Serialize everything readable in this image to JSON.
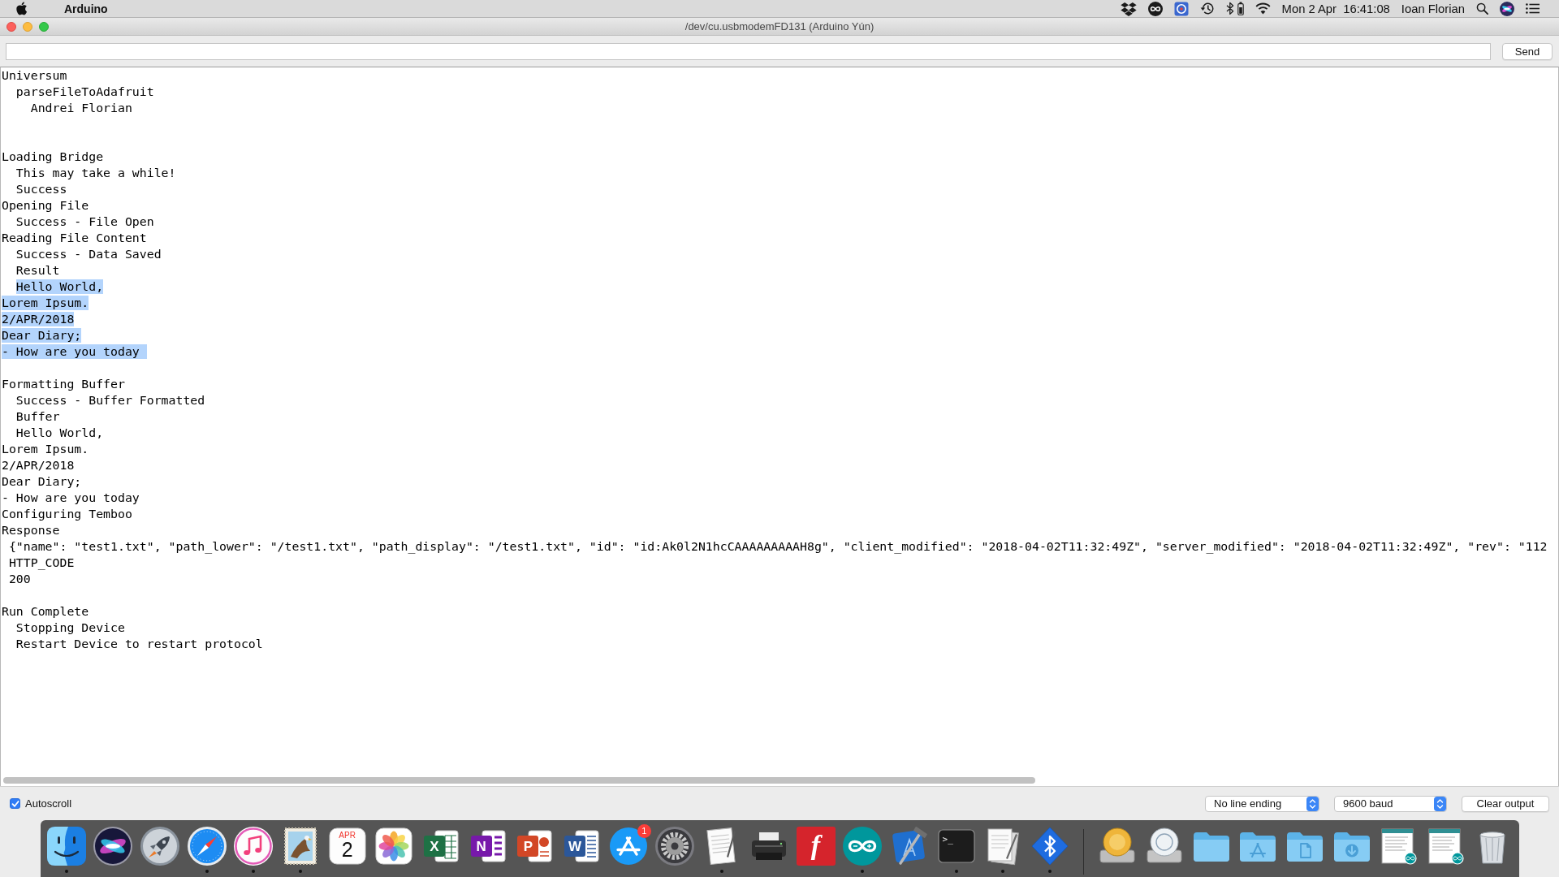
{
  "menu_bar": {
    "app_name": "Arduino",
    "clock": "Mon 2 Apr  16:41:08",
    "user_name": "Ioan Florian"
  },
  "window": {
    "title": "/dev/cu.usbmodemFD131 (Arduino Yún)"
  },
  "send_button": "Send",
  "output": {
    "lines": [
      {
        "kind": "text",
        "text": "Universum",
        "selected": false
      },
      {
        "kind": "text",
        "text": "  parseFileToAdafruit",
        "selected": false
      },
      {
        "kind": "text",
        "text": "    Andrei Florian",
        "selected": false
      },
      {
        "kind": "blank",
        "selected": false
      },
      {
        "kind": "blank",
        "selected": false
      },
      {
        "kind": "text",
        "text": "Loading Bridge",
        "selected": false
      },
      {
        "kind": "text",
        "text": "  This may take a while!",
        "selected": false
      },
      {
        "kind": "text",
        "text": "  Success",
        "selected": false
      },
      {
        "kind": "text",
        "text": "Opening File",
        "selected": false
      },
      {
        "kind": "text",
        "text": "  Success - File Open",
        "selected": false
      },
      {
        "kind": "text",
        "text": "Reading File Content",
        "selected": false
      },
      {
        "kind": "text",
        "text": "  Success - Data Saved",
        "selected": false
      },
      {
        "kind": "text",
        "text": "  Result",
        "selected": false
      },
      {
        "kind": "text",
        "text": "  Hello World,",
        "selected": true
      },
      {
        "kind": "text",
        "text": "Lorem Ipsum.",
        "selected": true
      },
      {
        "kind": "text",
        "text": "2/APR/2018",
        "selected": true
      },
      {
        "kind": "text",
        "text": "Dear Diary;",
        "selected": true
      },
      {
        "kind": "text",
        "text": "- How are you today ",
        "selected": true
      },
      {
        "kind": "blank",
        "selected": false
      },
      {
        "kind": "text",
        "text": "Formatting Buffer",
        "selected": false
      },
      {
        "kind": "text",
        "text": "  Success - Buffer Formatted",
        "selected": false
      },
      {
        "kind": "text",
        "text": "  Buffer",
        "selected": false
      },
      {
        "kind": "text",
        "text": "  Hello World,",
        "selected": false
      },
      {
        "kind": "text",
        "text": "Lorem Ipsum.",
        "selected": false
      },
      {
        "kind": "text",
        "text": "2/APR/2018",
        "selected": false
      },
      {
        "kind": "text",
        "text": "Dear Diary;",
        "selected": false
      },
      {
        "kind": "text",
        "text": "- How are you today",
        "selected": false
      },
      {
        "kind": "text",
        "text": "Configuring Temboo",
        "selected": false
      },
      {
        "kind": "text",
        "text": "Response",
        "selected": false
      },
      {
        "kind": "text",
        "text": " {\"name\": \"test1.txt\", \"path_lower\": \"/test1.txt\", \"path_display\": \"/test1.txt\", \"id\": \"id:Ak0l2N1hcCAAAAAAAAAH8g\", \"client_modified\": \"2018-04-02T11:32:49Z\", \"server_modified\": \"2018-04-02T11:32:49Z\", \"rev\": \"112",
        "selected": false
      },
      {
        "kind": "text",
        "text": " HTTP_CODE",
        "selected": false
      },
      {
        "kind": "text",
        "text": " 200",
        "selected": false
      },
      {
        "kind": "blank",
        "selected": false
      },
      {
        "kind": "text",
        "text": "Run Complete",
        "selected": false
      },
      {
        "kind": "text",
        "text": "  Stopping Device",
        "selected": false
      },
      {
        "kind": "text",
        "text": "  Restart Device to restart protocol",
        "selected": false
      }
    ]
  },
  "bottom_bar": {
    "autoscroll": {
      "label": "Autoscroll",
      "checked": true
    },
    "line_ending": "No line ending",
    "baud_rate": "9600 baud",
    "clear_button": "Clear output"
  },
  "dock": {
    "apps": [
      {
        "kind": "face",
        "running": true
      },
      {
        "kind": "orb",
        "running": false
      },
      {
        "kind": "rocket",
        "running": false
      },
      {
        "kind": "compass",
        "running": true
      },
      {
        "kind": "music",
        "running": true
      },
      {
        "kind": "stamp",
        "running": true
      },
      {
        "kind": "calendar",
        "month": "APR",
        "day": "2",
        "running": false
      },
      {
        "kind": "flower",
        "running": false
      },
      {
        "kind": "sheet",
        "icon_text": "X",
        "running": false
      },
      {
        "kind": "notebook",
        "icon_text": "N",
        "running": false
      },
      {
        "kind": "slides",
        "icon_text": "P",
        "running": false
      },
      {
        "kind": "doc",
        "icon_text": "W",
        "running": false
      },
      {
        "kind": "store",
        "badge": "1",
        "running": false
      },
      {
        "kind": "gear",
        "running": false
      },
      {
        "kind": "notepad",
        "running": true
      },
      {
        "kind": "printer",
        "running": false
      },
      {
        "kind": "tile",
        "icon_text": "f",
        "running": false
      },
      {
        "kind": "infinity",
        "running": true
      },
      {
        "kind": "blueprint",
        "running": false
      },
      {
        "kind": "terminal",
        "icon_text": ">_",
        "running": true
      },
      {
        "kind": "papers",
        "running": true
      },
      {
        "kind": "bluetooth",
        "running": true
      }
    ],
    "stacks": [
      {
        "kind": "drive_gold"
      },
      {
        "kind": "drive_white"
      },
      {
        "kind": "folder"
      },
      {
        "kind": "folder_apps"
      },
      {
        "kind": "folder_documents"
      },
      {
        "kind": "folder_downloads"
      },
      {
        "kind": "window"
      },
      {
        "kind": "window"
      },
      {
        "kind": "trash"
      }
    ]
  }
}
